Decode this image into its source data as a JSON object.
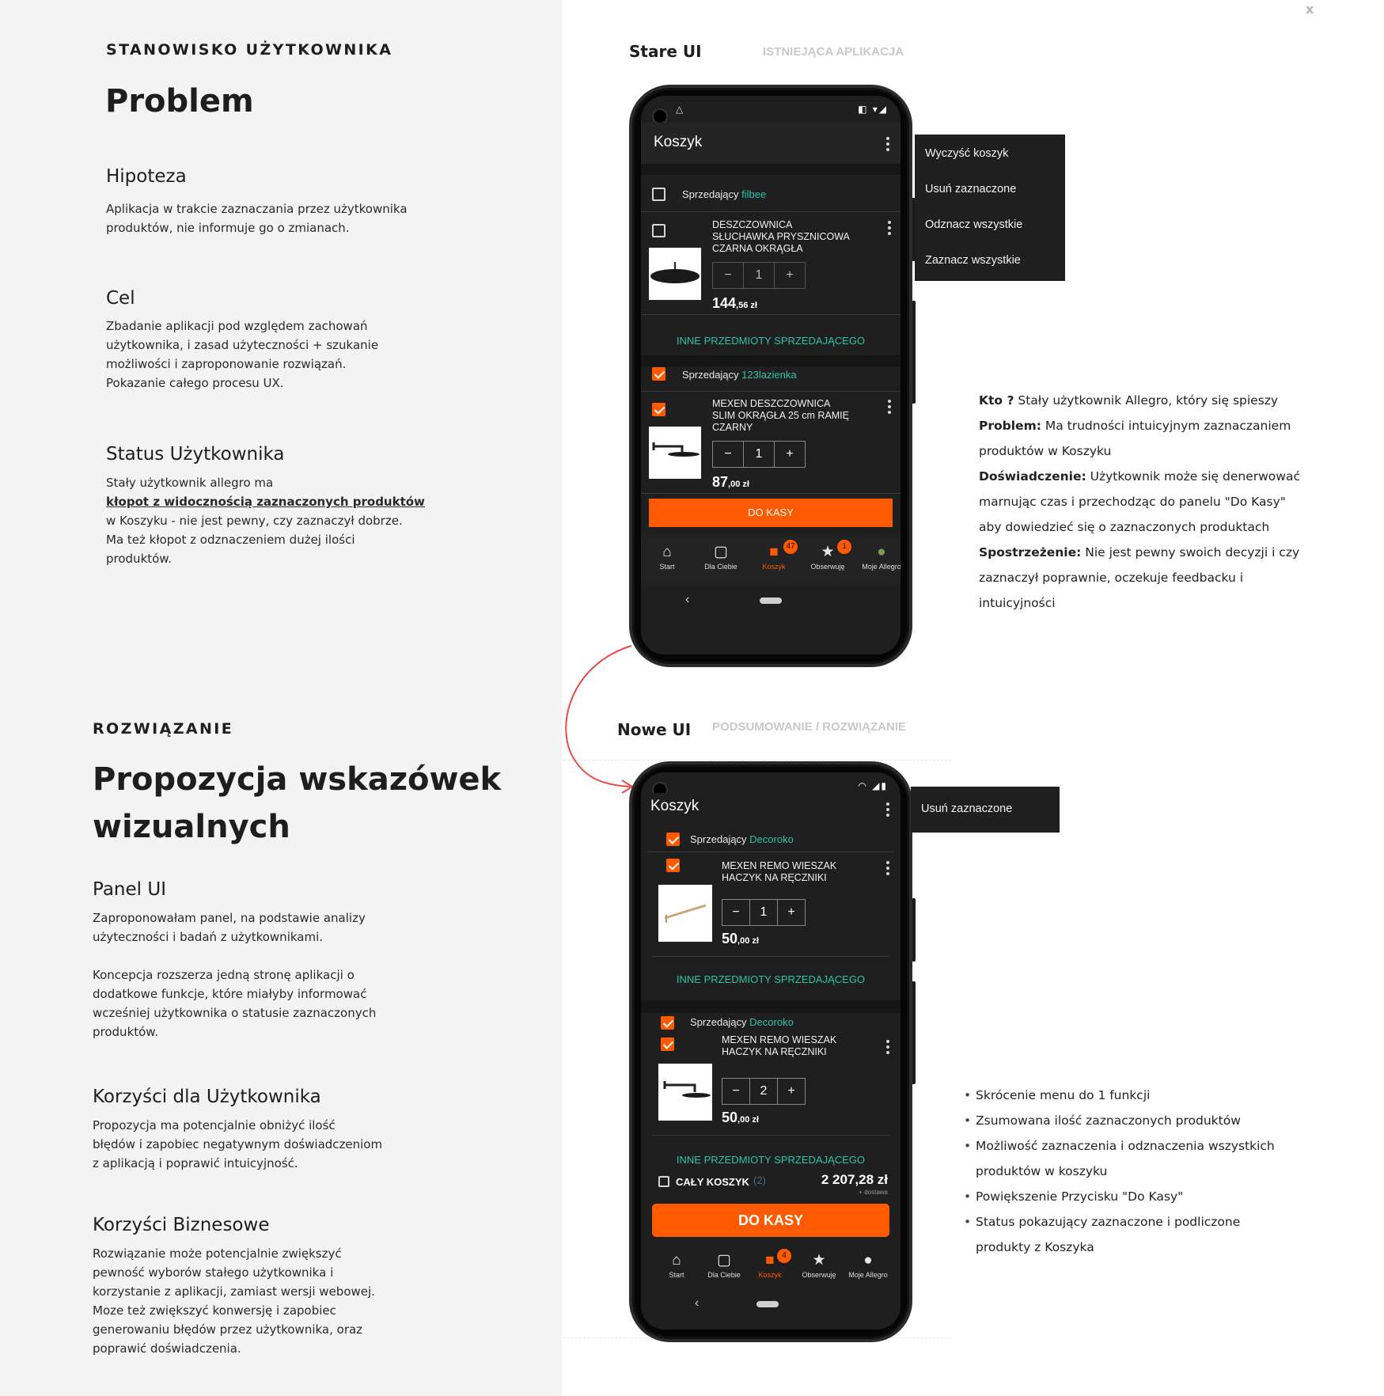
{
  "close_label": "x",
  "left": {
    "section1": {
      "eyebrow": "STANOWISKO UŻYTKOWNIKA",
      "title": "Problem",
      "hipoteza": {
        "heading": "Hipoteza",
        "text": "Aplikacja w trakcie zaznaczania przez użytkownika\nproduktów, nie informuje go o zmianach."
      },
      "cel": {
        "heading": "Cel",
        "text": "Zbadanie aplikacji pod względem zachowań\nużytkownika, i zasad użyteczności + szukanie\nmożliwości i zaproponowanie rozwiązań.\nPokazanie całego procesu UX."
      },
      "status": {
        "heading": "Status Użytkownika",
        "line1": "Stały użytkownik allegro ma",
        "underlined": "kłopot z widocznością zaznaczonych produktów",
        "text": "w Koszyku - nie jest pewny, czy zaznaczył dobrze.\nMa też kłopot z odznaczeniem dużej ilości\nproduktów."
      }
    },
    "section2": {
      "eyebrow": "ROZWIĄZANIE",
      "title_line1": "Propozycja wskazówek",
      "title_line2": "wizualnych",
      "panel": {
        "heading": "Panel UI",
        "text": "Zaproponowałam panel, na podstawie analizy\nużyteczności i badań z użytkownikami.\n\nKoncepcja rozszerza jedną stronę aplikacji o\ndodatkowe funkcje, które miałyby informować\nwcześniej użytkownika o statusie zaznaczonych\nproduktów."
      },
      "korzysci_user": {
        "heading": "Korzyści dla Użytkownika",
        "text": "Propozycja ma potencjalnie obniżyć ilość\nbłędów i zapobiec negatywnym doświadczeniom\nz aplikacją i poprawić intuicyjność."
      },
      "korzysci_biz": {
        "heading": "Korzyści Biznesowe",
        "text": "Rozwiązanie może potencjalnie zwiększyć\npewność wyborów stałego użytkownika i\nkorzystanie z aplikacji, zamiast wersji webowej.\nMoze też zwiększyć konwersję i zapobiec\ngenerowaniu błędów przez użytkownika, oraz\npoprawić doświadczenia."
      }
    }
  },
  "old_ui": {
    "title": "Stare UI",
    "subtitle": "ISTNIEJĄCA APLIKACJA",
    "appbar_title": "Koszyk",
    "seller1": {
      "label": "Sprzedający",
      "name": "filbee"
    },
    "item1": {
      "name": "DESZCZOWNICA SŁUCHAWKA PRYSZNICOWA CZARNA OKRĄGŁA",
      "qty": "1",
      "price_main": "144",
      "price_dec": ",56 zł"
    },
    "other_items": "INNE PRZEDMIOTY SPRZEDAJĄCEGO",
    "seller2": {
      "label": "Sprzedający",
      "name": "123lazienka"
    },
    "item2": {
      "name": "MEXEN DESZCZOWNICA SLIM OKRĄGŁA 25 cm RAMIĘ CZARNY",
      "qty": "1",
      "price_main": "87",
      "price_dec": ",00 zł"
    },
    "cta": "DO KASY",
    "nav": [
      {
        "label": "Start",
        "icon": "home-icon",
        "glyph": "⌂"
      },
      {
        "label": "Dla Ciebie",
        "icon": "cast-icon",
        "glyph": "▢"
      },
      {
        "label": "Koszyk",
        "icon": "bag-icon",
        "glyph": "■",
        "badge": "47"
      },
      {
        "label": "Obserwuję",
        "icon": "star-icon",
        "glyph": "★",
        "badge": "1"
      },
      {
        "label": "Moje Allegro",
        "icon": "avatar-icon",
        "glyph": "●"
      }
    ],
    "menu": [
      "Wyczyść koszyk",
      "Usuń zaznaczone",
      "Odznacz wszystkie",
      "Zaznacz wszystkie"
    ]
  },
  "persona": {
    "kto_label": "Kto ?",
    "kto": " Stały użytkownik Allegro, który się spieszy",
    "problem_label": "Problem:",
    "problem": " Ma trudności intuicyjnym zaznaczaniem produktów w Koszyku",
    "dosw_label": "Doświadczenie:",
    "dosw": " Użytkownik może się denerwować marnując czas i przechodząc do panelu \"Do Kasy\" aby dowiedzieć się o zaznaczonych produktach",
    "spostrz_label": "Spostrzeżenie:",
    "spostrz": " Nie jest pewny swoich decyzji i czy zaznaczył poprawnie, oczekuje feedbacku i intuicyjności"
  },
  "new_ui": {
    "title": "Nowe UI",
    "subtitle": "PODSUMOWANIE / ROZWIĄZANIE",
    "appbar_title": "Koszyk",
    "seller1": {
      "label": "Sprzedający",
      "name": "Decoroko"
    },
    "item1": {
      "name": "MEXEN REMO WIESZAK HACZYK NA RĘCZNIKI",
      "qty": "1",
      "price_main": "50",
      "price_dec": ",00 zł"
    },
    "other_items1": "INNE PRZEDMIOTY SPRZEDAJĄCEGO",
    "seller2": {
      "label": "Sprzedający",
      "name": "Decoroko"
    },
    "item2": {
      "name": "MEXEN REMO WIESZAK HACZYK NA RĘCZNIKI",
      "qty": "2",
      "price_main": "50",
      "price_dec": ",00 zł"
    },
    "other_items2": "INNE PRZEDMIOTY SPRZEDAJĄCEGO",
    "whole_cart": "CAŁY KOSZYK",
    "selected_count": "(2)",
    "total": "2 207,28 zł",
    "shipping": "+ dostawa",
    "cta": "DO KASY",
    "nav": [
      {
        "label": "Start",
        "icon": "home-icon",
        "glyph": "⌂"
      },
      {
        "label": "Dla Ciebie",
        "icon": "cast-icon",
        "glyph": "▢"
      },
      {
        "label": "Koszyk",
        "icon": "bag-icon",
        "glyph": "■",
        "badge": "4"
      },
      {
        "label": "Obserwuję",
        "icon": "star-icon",
        "glyph": "★"
      },
      {
        "label": "Moje Allegro",
        "icon": "avatar-icon",
        "glyph": "●"
      }
    ],
    "menu": [
      "Usuń zaznaczone"
    ]
  },
  "bullets": [
    "Skrócenie menu do 1 funkcji",
    "Zsumowana ilość zaznaczonych produktów",
    "Możliwość zaznaczenia i odznaczenia wszystkich produktów w koszyku",
    "Powiększenie Przycisku \"Do Kasy\"",
    "Status pokazujący  zaznaczone i podliczone produkty z Koszyka"
  ],
  "colors": {
    "accent": "#ff5a00",
    "teal": "#2fc3a7",
    "dark": "#1f1f1f",
    "arrow": "#e84a4a"
  }
}
